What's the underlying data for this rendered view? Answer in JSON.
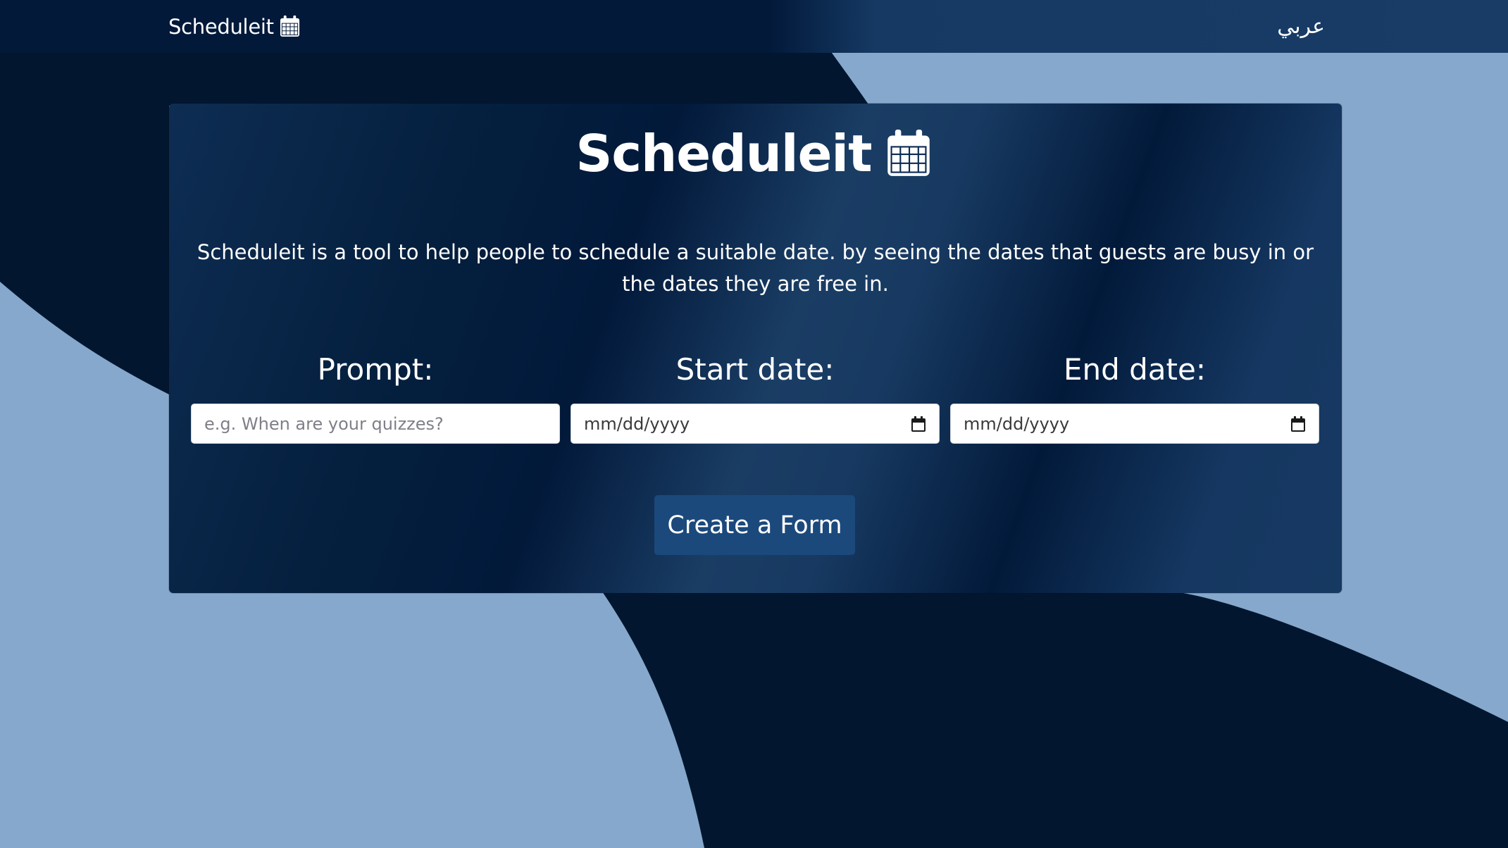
{
  "colors": {
    "page_light": "#86a8cc",
    "page_dark": "#02172f",
    "navbar": "#02193a",
    "card": "#0e2d53",
    "button": "#1b497c",
    "text": "#ffffff"
  },
  "navbar": {
    "brand": "Scheduleit",
    "brand_icon": "calendar-icon",
    "language_link": "عربي"
  },
  "card": {
    "title": "Scheduleit",
    "title_icon": "calendar-icon",
    "description": "Scheduleit is a tool to help people to schedule a suitable date. by seeing the dates that guests are busy in or the dates they are free in."
  },
  "form": {
    "prompt": {
      "label": "Prompt:",
      "placeholder": "e.g. When are your quizzes?",
      "value": ""
    },
    "start_date": {
      "label": "Start date:",
      "value": "mm/dd/yyyy",
      "icon": "calendar-icon"
    },
    "end_date": {
      "label": "End date:",
      "value": "mm/dd/yyyy",
      "icon": "calendar-icon"
    },
    "submit_label": "Create a Form"
  }
}
